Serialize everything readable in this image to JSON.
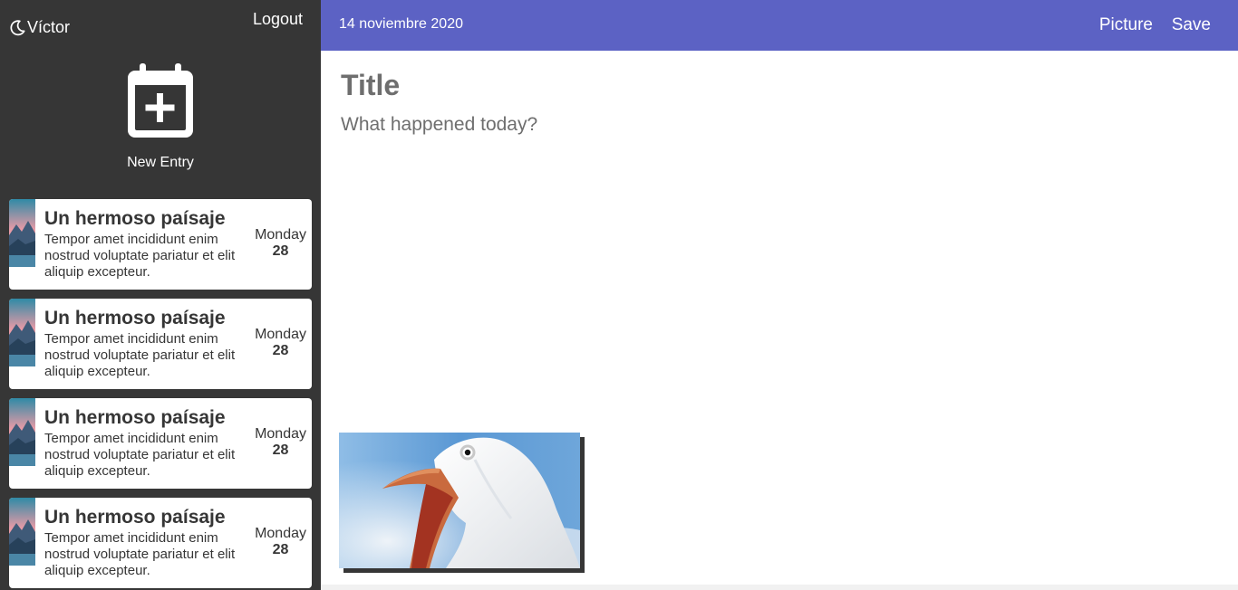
{
  "sidebar": {
    "user_name": "Víctor",
    "logout_label": "Logout",
    "new_entry_label": "New Entry",
    "entries": [
      {
        "title": "Un hermoso paísaje",
        "body": "Tempor amet incididunt enim nostrud voluptate pariatur et elit aliquip excepteur.",
        "day": "Monday",
        "date": "28"
      },
      {
        "title": "Un hermoso paísaje",
        "body": "Tempor amet incididunt enim nostrud voluptate pariatur et elit aliquip excepteur.",
        "day": "Monday",
        "date": "28"
      },
      {
        "title": "Un hermoso paísaje",
        "body": "Tempor amet incididunt enim nostrud voluptate pariatur et elit aliquip excepteur.",
        "day": "Monday",
        "date": "28"
      },
      {
        "title": "Un hermoso paísaje",
        "body": "Tempor amet incididunt enim nostrud voluptate pariatur et elit aliquip excepteur.",
        "day": "Monday",
        "date": "28"
      }
    ]
  },
  "toolbar": {
    "date": "14 noviembre 2020",
    "picture_label": "Picture",
    "save_label": "Save"
  },
  "editor": {
    "title_placeholder": "Title",
    "body_placeholder": "What happened today?"
  },
  "icons": {
    "user": "moon-icon",
    "new_entry": "calendar-plus-icon",
    "entry_thumb": "landscape-thumbnail",
    "photo": "seagull-photo"
  },
  "colors": {
    "sidebar_bg": "#363636",
    "topbar_bg": "#5c62c4",
    "text_muted": "#6e6e6e"
  }
}
